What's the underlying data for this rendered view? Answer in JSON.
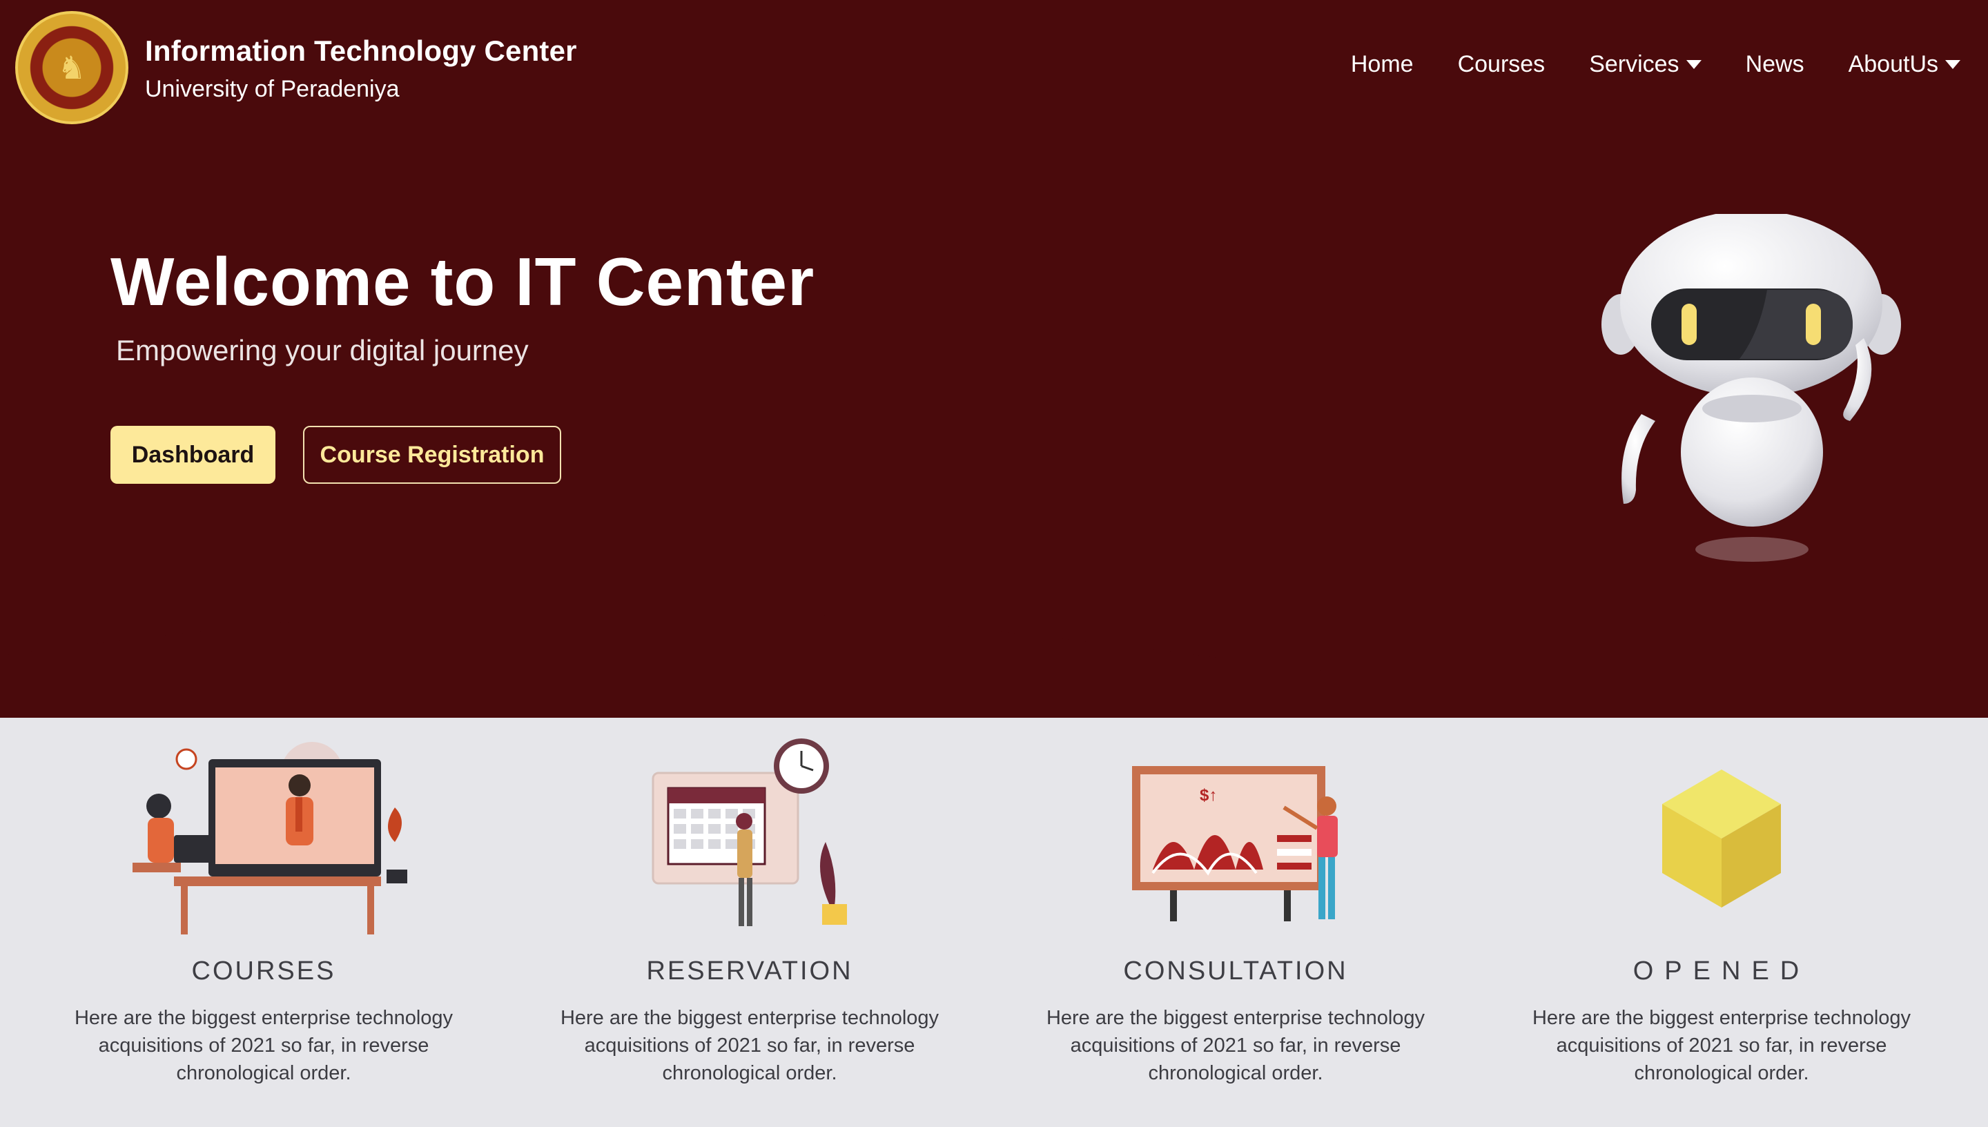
{
  "brand": {
    "title": "Information Technology Center",
    "subtitle": "University of Peradeniya"
  },
  "nav": [
    {
      "label": "Home",
      "has_dropdown": false
    },
    {
      "label": "Courses",
      "has_dropdown": false
    },
    {
      "label": "Services",
      "has_dropdown": true
    },
    {
      "label": "News",
      "has_dropdown": false
    },
    {
      "label": "AboutUs",
      "has_dropdown": true
    }
  ],
  "hero": {
    "title": "Welcome to IT Center",
    "subtitle": "Empowering your digital journey",
    "primary_button": "Dashboard",
    "secondary_button": "Course Registration"
  },
  "features": [
    {
      "title": "COURSES",
      "description": "Here are the biggest enterprise technology acquisitions of 2021 so far, in reverse chronological order."
    },
    {
      "title": "RESERVATION",
      "description": "Here are the biggest enterprise technology acquisitions of 2021 so far, in reverse chronological order."
    },
    {
      "title": "CONSULTATION",
      "description": "Here are the biggest enterprise technology acquisitions of 2021 so far, in reverse chronological order."
    },
    {
      "title": "OPENED",
      "description": "Here are the biggest enterprise technology acquisitions of 2021 so far, in reverse chronological order."
    }
  ],
  "colors": {
    "hero_bg": "#4a0a0c",
    "page_bg": "#e6e6ea",
    "accent_yellow": "#fde99a",
    "text_dark": "#3e3e44"
  },
  "icons": {
    "logo": "university-crest-icon",
    "dropdown": "caret-down-icon",
    "robot": "robot-mascot-icon"
  }
}
